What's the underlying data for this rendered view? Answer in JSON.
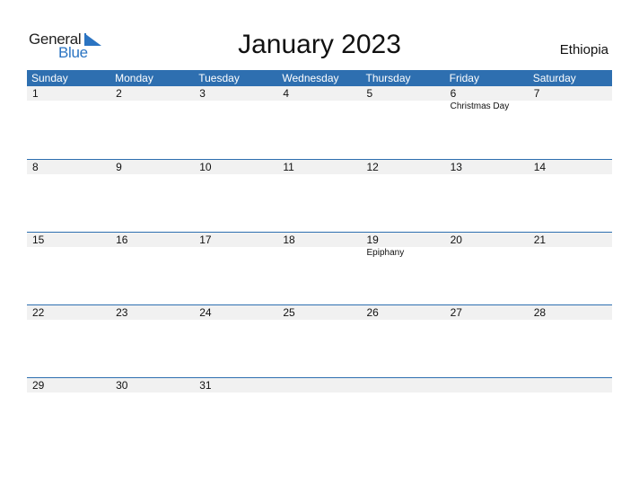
{
  "brand": {
    "line1": "General",
    "line2": "Blue",
    "accent_color": "#2b74c2"
  },
  "title": "January 2023",
  "country": "Ethiopia",
  "header_color": "#2e6fb0",
  "weekdays": [
    "Sunday",
    "Monday",
    "Tuesday",
    "Wednesday",
    "Thursday",
    "Friday",
    "Saturday"
  ],
  "weeks": [
    [
      {
        "day": "1",
        "event": ""
      },
      {
        "day": "2",
        "event": ""
      },
      {
        "day": "3",
        "event": ""
      },
      {
        "day": "4",
        "event": ""
      },
      {
        "day": "5",
        "event": ""
      },
      {
        "day": "6",
        "event": "Christmas Day"
      },
      {
        "day": "7",
        "event": ""
      }
    ],
    [
      {
        "day": "8",
        "event": ""
      },
      {
        "day": "9",
        "event": ""
      },
      {
        "day": "10",
        "event": ""
      },
      {
        "day": "11",
        "event": ""
      },
      {
        "day": "12",
        "event": ""
      },
      {
        "day": "13",
        "event": ""
      },
      {
        "day": "14",
        "event": ""
      }
    ],
    [
      {
        "day": "15",
        "event": ""
      },
      {
        "day": "16",
        "event": ""
      },
      {
        "day": "17",
        "event": ""
      },
      {
        "day": "18",
        "event": ""
      },
      {
        "day": "19",
        "event": "Epiphany"
      },
      {
        "day": "20",
        "event": ""
      },
      {
        "day": "21",
        "event": ""
      }
    ],
    [
      {
        "day": "22",
        "event": ""
      },
      {
        "day": "23",
        "event": ""
      },
      {
        "day": "24",
        "event": ""
      },
      {
        "day": "25",
        "event": ""
      },
      {
        "day": "26",
        "event": ""
      },
      {
        "day": "27",
        "event": ""
      },
      {
        "day": "28",
        "event": ""
      }
    ],
    [
      {
        "day": "29",
        "event": ""
      },
      {
        "day": "30",
        "event": ""
      },
      {
        "day": "31",
        "event": ""
      },
      {
        "day": "",
        "event": ""
      },
      {
        "day": "",
        "event": ""
      },
      {
        "day": "",
        "event": ""
      },
      {
        "day": "",
        "event": ""
      }
    ]
  ]
}
